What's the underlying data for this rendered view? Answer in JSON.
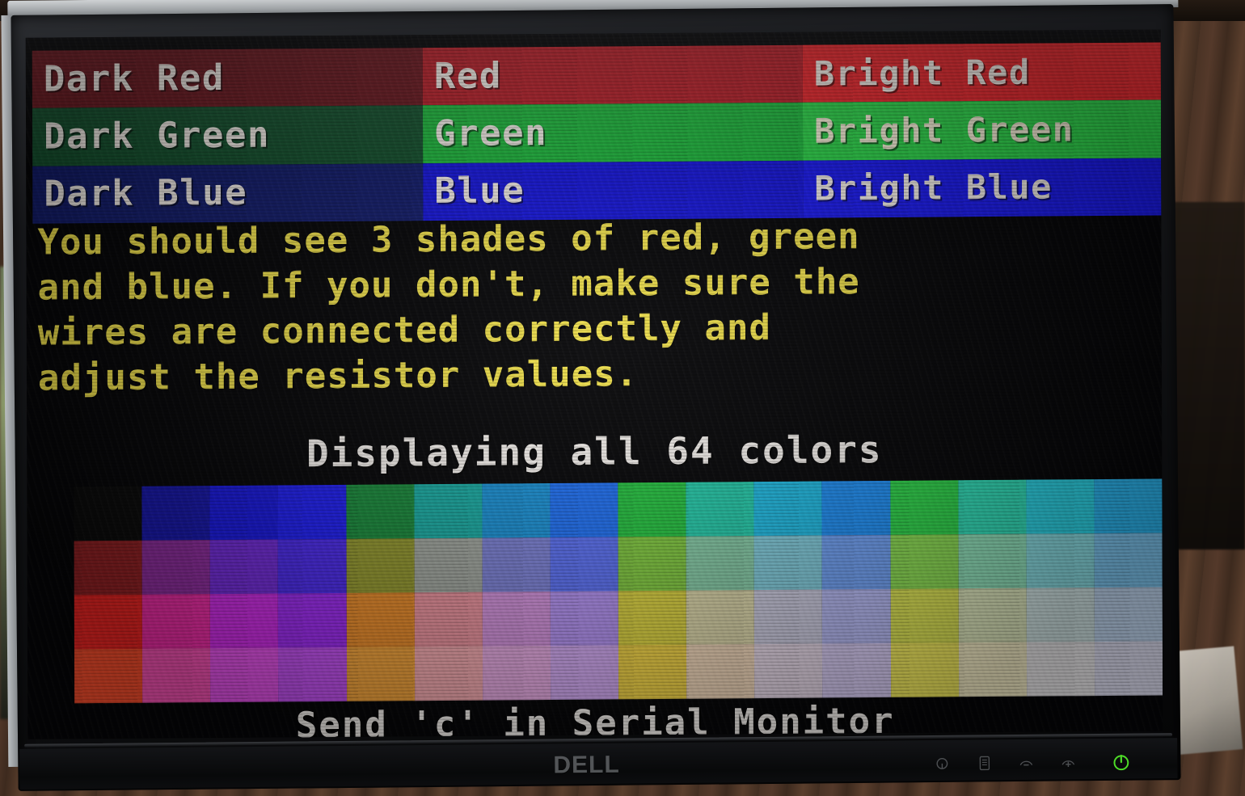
{
  "scene": {
    "device": "Dell LCD monitor",
    "monitor_brand": "DELL",
    "osd_buttons": [
      {
        "name": "input-select-icon",
        "glyph": "input-source"
      },
      {
        "name": "menu-icon",
        "glyph": "menu"
      },
      {
        "name": "minus-icon",
        "glyph": "minus"
      },
      {
        "name": "plus-icon",
        "glyph": "plus"
      },
      {
        "name": "power-icon",
        "glyph": "power"
      }
    ],
    "power_led_color": "#4ddb27"
  },
  "screen": {
    "background": "#050507",
    "color_bars": {
      "rows": [
        {
          "name": "red",
          "cells": [
            {
              "label": "Dark Red",
              "bg": "#6b1820",
              "fg": "#f4eee8"
            },
            {
              "label": "Red",
              "bg": "#b8202a",
              "fg": "#f4eee8"
            },
            {
              "label": "Bright Red",
              "bg": "#e8262c",
              "fg": "#f4eee8"
            }
          ]
        },
        {
          "name": "green",
          "cells": [
            {
              "label": "Dark Green",
              "bg": "#15522f",
              "fg": "#f4eee8"
            },
            {
              "label": "Green",
              "bg": "#1fb83e",
              "fg": "#f4eee8"
            },
            {
              "label": "Bright Green",
              "bg": "#2dd44a",
              "fg": "#f7f0d8"
            }
          ]
        },
        {
          "name": "blue",
          "cells": [
            {
              "label": "Dark Blue",
              "bg": "#131d6d",
              "fg": "#f4eee8"
            },
            {
              "label": "Blue",
              "bg": "#1616dc",
              "fg": "#f4eee8"
            },
            {
              "label": "Bright Blue",
              "bg": "#1a1aee",
              "fg": "#f4eee8"
            }
          ]
        }
      ]
    },
    "instructions": {
      "color": "#f2e24c",
      "lines": [
        "You should see 3 shades of red, green",
        "and blue. If you don't, make sure the",
        "wires are connected correctly and",
        "adjust the resistor values."
      ]
    },
    "headline": "Displaying all 64 colors",
    "footer": "Send 'c' in Serial Monitor",
    "palette": {
      "description": "64-color 6-bit VGA palette, 16 columns x 4 rows",
      "columns": 16,
      "rows": 4,
      "colors": [
        "#0a0a0a",
        "#1616a8",
        "#1818dc",
        "#1f1ff0",
        "#1a8a3c",
        "#19a8a0",
        "#1a8fd2",
        "#1f6ff0",
        "#25c040",
        "#24c8a8",
        "#1fb8e0",
        "#1f8ef2",
        "#2ed24a",
        "#2fd8b4",
        "#2ad0e2",
        "#2ab4ee",
        "#8e1f22",
        "#8a2b9a",
        "#6f2ad4",
        "#4a2ae8",
        "#93972f",
        "#9ea39c",
        "#7a7fd2",
        "#5a6ff0",
        "#7fc63f",
        "#84c8a4",
        "#7fc8d8",
        "#6f9ff2",
        "#8ada52",
        "#8cdcb6",
        "#86d8de",
        "#7cc4ee",
        "#e62321",
        "#e62aa0",
        "#c92ae0",
        "#9b2aee",
        "#e78a2a",
        "#e68f9a",
        "#cf8fd8",
        "#b08fee",
        "#d8cf3f",
        "#d8d2a6",
        "#c7c6da",
        "#b3b6f0",
        "#d9e052",
        "#d9e2b8",
        "#cde0e0",
        "#bed4ee",
        "#f04a2a",
        "#ef4fae",
        "#df4fe4",
        "#c04fee",
        "#f0a13a",
        "#f0a6ac",
        "#e2a6de",
        "#cfa6ef",
        "#eed044",
        "#edd3b6",
        "#e1d3e2",
        "#d4c8f0",
        "#f0e85c",
        "#f1e9c2",
        "#e8e6e8",
        "#dcdcef"
      ]
    }
  }
}
